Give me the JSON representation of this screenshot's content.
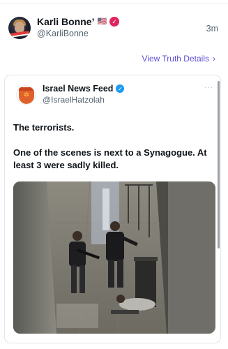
{
  "post": {
    "author": {
      "display_name": "Karli Bonne’",
      "flag": "🇺🇸",
      "badge_icon": "verified-red-badge-icon",
      "handle": "@KarliBonne"
    },
    "time": "3m",
    "view_truth_label": "View Truth Details",
    "chevron": "›"
  },
  "quote": {
    "author": {
      "display_name": "Israel News Feed",
      "badge_icon": "verified-blue-badge-icon",
      "handle": "@IsraelHatzolah",
      "avatar_text": "ISRAEL"
    },
    "more": "···",
    "paragraphs": [
      "The terrorists.",
      "One of the scenes is next to a Synagogue. At least 3 were sadly killed."
    ],
    "media_icon": "security-camera-photo"
  },
  "colors": {
    "link": "#5b4fd6",
    "verified_red": "#e0245e",
    "verified_blue": "#1d9bf0",
    "muted": "#536471"
  }
}
